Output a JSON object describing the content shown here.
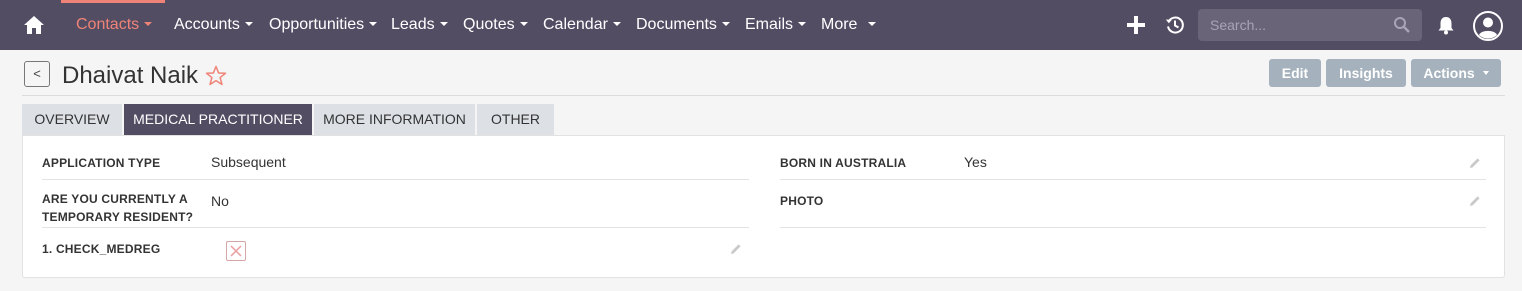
{
  "nav": {
    "items": [
      {
        "label": "Contacts",
        "active": true
      },
      {
        "label": "Accounts"
      },
      {
        "label": "Opportunities"
      },
      {
        "label": "Leads"
      },
      {
        "label": "Quotes"
      },
      {
        "label": "Calendar"
      },
      {
        "label": "Documents"
      },
      {
        "label": "Emails"
      },
      {
        "label": "More"
      }
    ],
    "search_placeholder": "Search...",
    "icons": [
      "home-icon",
      "plus-icon",
      "history-icon",
      "search-icon",
      "bell-icon",
      "user-avatar-icon"
    ]
  },
  "header": {
    "back_label": "<",
    "title": "Dhaivat Naik",
    "buttons": {
      "edit": "Edit",
      "insights": "Insights",
      "actions": "Actions"
    }
  },
  "tabs": [
    {
      "label": "OVERVIEW"
    },
    {
      "label": "MEDICAL PRACTITIONER",
      "active": true
    },
    {
      "label": "MORE INFORMATION"
    },
    {
      "label": "OTHER"
    }
  ],
  "fields": {
    "application_type": {
      "label": "APPLICATION TYPE",
      "value": "Subsequent"
    },
    "born_in_australia": {
      "label": "BORN IN AUSTRALIA",
      "value": "Yes"
    },
    "temporary_resident": {
      "label_line1": "ARE YOU CURRENTLY A",
      "label_line2": "TEMPORARY RESIDENT?",
      "value": "No"
    },
    "photo": {
      "label": "PHOTO",
      "value": ""
    },
    "check_medreg": {
      "label": "1. CHECK_MEDREG",
      "checked": false
    }
  },
  "colors": {
    "nav_bg": "#534d64",
    "accent": "#f08377",
    "button_bg": "#a5b2bd",
    "tab_bg": "#dde1e6"
  }
}
